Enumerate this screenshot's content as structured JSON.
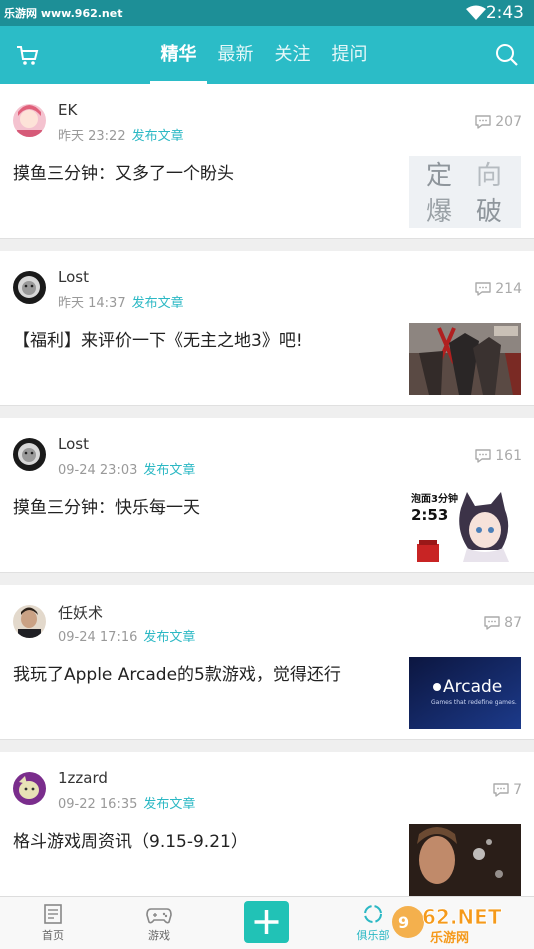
{
  "status": {
    "watermark": "乐游网 www.962.net",
    "time": "2:43"
  },
  "header": {
    "tabs": [
      "精华",
      "最新",
      "关注",
      "提问"
    ],
    "active_tab": 0
  },
  "posts": [
    {
      "user": "EK",
      "time": "昨天 23:22",
      "action": "发布文章",
      "count": "207",
      "title": "摸鱼三分钟：又多了一个盼头"
    },
    {
      "user": "Lost",
      "time": "昨天 14:37",
      "action": "发布文章",
      "count": "214",
      "title": "【福利】来评价一下《无主之地3》吧!"
    },
    {
      "user": "Lost",
      "time": "09-24 23:03",
      "action": "发布文章",
      "count": "161",
      "title": "摸鱼三分钟：快乐每一天"
    },
    {
      "user": "任妖术",
      "time": "09-24 17:16",
      "action": "发布文章",
      "count": "87",
      "title": "我玩了Apple Arcade的5款游戏，觉得还行"
    },
    {
      "user": "1zzard",
      "time": "09-22 16:35",
      "action": "发布文章",
      "count": "7",
      "title": "格斗游戏周资讯（9.15-9.21）"
    }
  ],
  "thumbs": {
    "t1": [
      "定",
      "向",
      "爆",
      "破"
    ],
    "t3_top": "泡面3分钟",
    "t3_time": "2:53",
    "t4_brand": "Arcade",
    "t4_sub": "Games that redefine games."
  },
  "bottom": {
    "home": "首页",
    "games": "游戏",
    "club": "俱乐部"
  },
  "colors": {
    "header": "#2bbcc7",
    "status": "#1d8f97",
    "accent": "#2bb8c4",
    "plus": "#21c2b6"
  },
  "icons": [
    "cart-icon",
    "search-icon",
    "comment-icon",
    "home-icon",
    "gamepad-icon",
    "plus-icon",
    "club-icon",
    "wifi-icon"
  ]
}
